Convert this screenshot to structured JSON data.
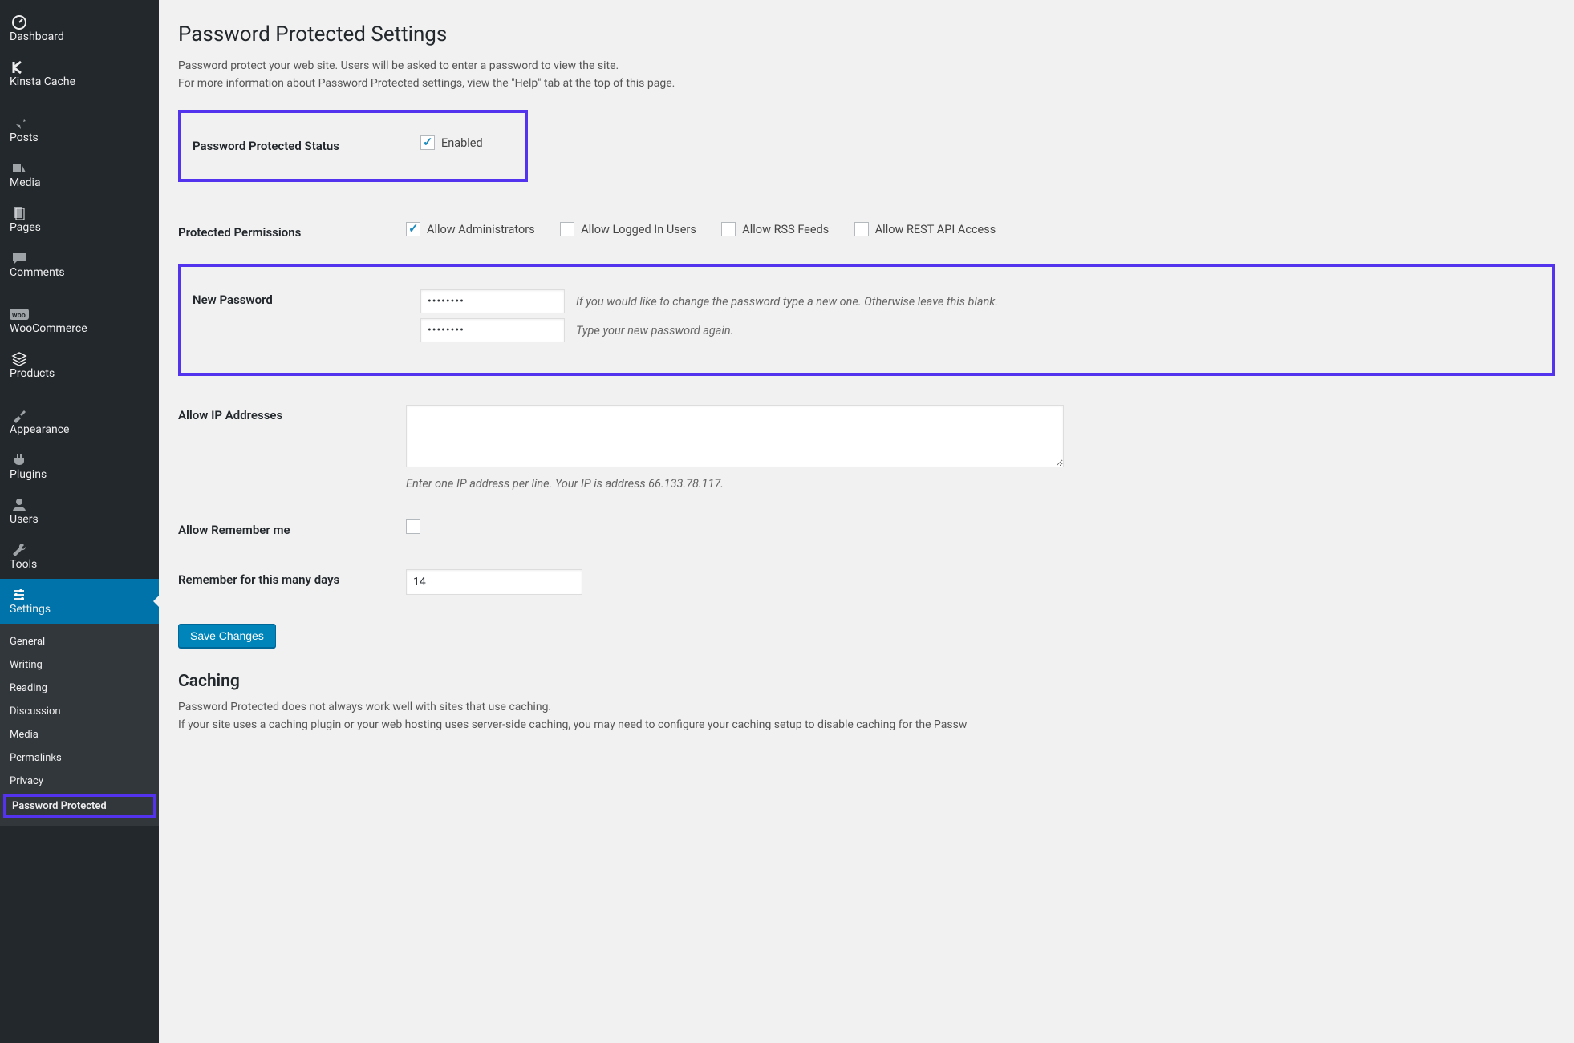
{
  "sidebar": {
    "items": [
      {
        "label": "Dashboard",
        "icon": "dashboard"
      },
      {
        "label": "Kinsta Cache",
        "icon": "kinsta"
      },
      {
        "label": "Posts",
        "icon": "pin"
      },
      {
        "label": "Media",
        "icon": "media"
      },
      {
        "label": "Pages",
        "icon": "pages"
      },
      {
        "label": "Comments",
        "icon": "comment"
      },
      {
        "label": "WooCommerce",
        "icon": "woo"
      },
      {
        "label": "Products",
        "icon": "products"
      },
      {
        "label": "Appearance",
        "icon": "appearance"
      },
      {
        "label": "Plugins",
        "icon": "plugins"
      },
      {
        "label": "Users",
        "icon": "users"
      },
      {
        "label": "Tools",
        "icon": "tools"
      },
      {
        "label": "Settings",
        "icon": "settings",
        "current": true
      }
    ],
    "submenu": [
      {
        "label": "General"
      },
      {
        "label": "Writing"
      },
      {
        "label": "Reading"
      },
      {
        "label": "Discussion"
      },
      {
        "label": "Media"
      },
      {
        "label": "Permalinks"
      },
      {
        "label": "Privacy"
      },
      {
        "label": "Password Protected",
        "current": true,
        "highlight": true
      }
    ]
  },
  "page": {
    "title": "Password Protected Settings",
    "description_line1": "Password protect your web site. Users will be asked to enter a password to view the site.",
    "description_line2": "For more information about Password Protected settings, view the \"Help\" tab at the top of this page."
  },
  "settings": {
    "status": {
      "label": "Password Protected Status",
      "checkbox_label": "Enabled",
      "checked": true
    },
    "permissions": {
      "label": "Protected Permissions",
      "options": [
        {
          "label": "Allow Administrators",
          "checked": true
        },
        {
          "label": "Allow Logged In Users",
          "checked": false
        },
        {
          "label": "Allow RSS Feeds",
          "checked": false
        },
        {
          "label": "Allow REST API Access",
          "checked": false
        }
      ]
    },
    "new_password": {
      "label": "New Password",
      "value1": "••••••••",
      "value2": "••••••••",
      "hint1": "If you would like to change the password type a new one. Otherwise leave this blank.",
      "hint2": "Type your new password again."
    },
    "allow_ip": {
      "label": "Allow IP Addresses",
      "value": "",
      "hint": "Enter one IP address per line. Your IP is address 66.133.78.117."
    },
    "remember_me": {
      "label": "Allow Remember me",
      "checked": false
    },
    "remember_days": {
      "label": "Remember for this many days",
      "value": "14"
    },
    "save_button": "Save Changes"
  },
  "caching": {
    "heading": "Caching",
    "line1": "Password Protected does not always work well with sites that use caching.",
    "line2": "If your site uses a caching plugin or your web hosting uses server-side caching, you may need to configure your caching setup to disable caching for the Passw"
  }
}
